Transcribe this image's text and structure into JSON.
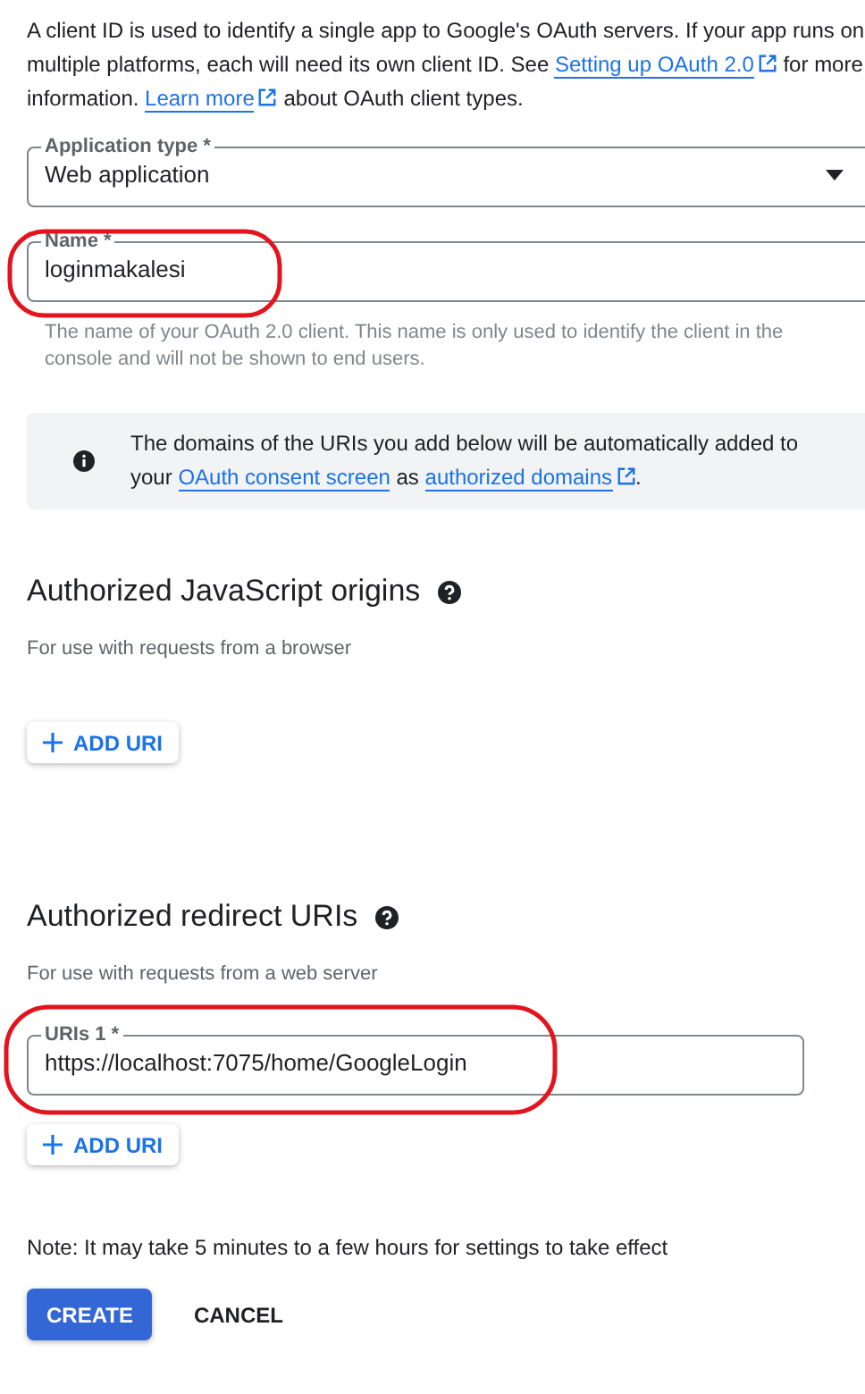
{
  "intro": [
    {
      "text": "A client ID is used to identify a single app to Google's OAuth servers. If your app runs on multiple platforms, each will need its own client ID. See ",
      "kind": "text"
    },
    {
      "text": "Setting up OAuth 2.0",
      "kind": "external_link"
    },
    {
      "text": " for more information. ",
      "kind": "text"
    },
    {
      "text": "Learn more",
      "kind": "external_link"
    },
    {
      "text": " about OAuth client types.",
      "kind": "text"
    }
  ],
  "application_type": {
    "label": "Application type *",
    "value": "Web application"
  },
  "name_field": {
    "label": "Name *",
    "value": "loginmakalesi",
    "circled": true,
    "hint": "The name of your OAuth 2.0 client. This name is only used to identify the client in the console and will not be shown to end users."
  },
  "info": [
    {
      "text": "The domains of the URIs you add below will be automatically added to your ",
      "kind": "text"
    },
    {
      "text": "OAuth consent screen",
      "kind": "link"
    },
    {
      "text": " as ",
      "kind": "text"
    },
    {
      "text": "authorized domains",
      "kind": "external_link"
    },
    {
      "text": ".",
      "kind": "text"
    }
  ],
  "sections": [
    {
      "title": "Authorized JavaScript origins",
      "subtitle": "For use with requests from a browser",
      "add_label": "ADD URI"
    },
    {
      "title": "Authorized redirect URIs",
      "subtitle": "For use with requests from a web server",
      "uris": [
        {
          "label": "URIs 1 *",
          "value": "https://localhost:7075/home/GoogleLogin",
          "circled": true
        }
      ],
      "add_label": "ADD URI"
    }
  ],
  "note": "Note: It may take 5 minutes to a few hours for settings to take effect",
  "buttons": [
    {
      "label": "CREATE",
      "kind": "primary"
    },
    {
      "label": "CANCEL",
      "kind": "text"
    }
  ]
}
